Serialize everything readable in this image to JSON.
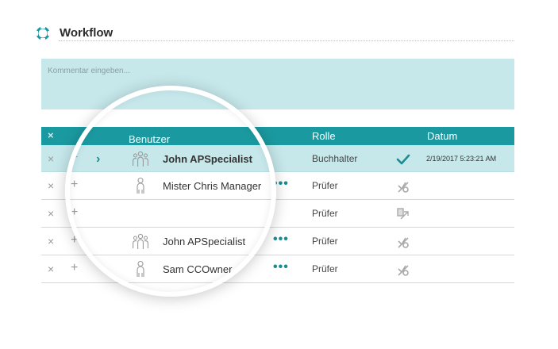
{
  "header": {
    "title": "Workflow",
    "logo_icon": "workflow-ring-icon"
  },
  "comment": {
    "placeholder": "Kommentar eingeben..."
  },
  "table": {
    "columns": {
      "user": "Benutzer",
      "role": "Rolle",
      "date": "Datum"
    },
    "clear_all_symbol": "×",
    "rows": [
      {
        "name": "John APSpecialist",
        "user_icon": "user-group-icon",
        "role": "Buchhalter",
        "status_icon": "check-icon",
        "date": "2/19/2017 5:23:21 AM",
        "active": true,
        "remove": "×",
        "add": "+",
        "expand": "›",
        "menu": ""
      },
      {
        "name": "Mister Chris Manager",
        "user_icon": "user-icon",
        "role": "Prüfer",
        "status_icon": "no-approval-icon",
        "date": "",
        "active": false,
        "remove": "×",
        "add": "+",
        "expand": "",
        "menu": "•••"
      },
      {
        "name": "",
        "user_icon": "",
        "role": "Prüfer",
        "status_icon": "forward-document-icon",
        "date": "",
        "active": false,
        "remove": "×",
        "add": "+",
        "expand": "",
        "menu": ""
      },
      {
        "name": "John APSpecialist",
        "user_icon": "user-group-icon",
        "role": "Prüfer",
        "status_icon": "no-approval-icon",
        "date": "",
        "active": false,
        "remove": "×",
        "add": "+",
        "expand": "",
        "menu": "•••"
      },
      {
        "name": "Sam CCOwner",
        "user_icon": "user-icon",
        "role": "Prüfer",
        "status_icon": "no-approval-icon",
        "date": "",
        "active": false,
        "remove": "×",
        "add": "+",
        "expand": "",
        "menu": "•••"
      }
    ]
  },
  "colors": {
    "accent": "#1a9aa0",
    "comment_bg": "#c6e8eb"
  }
}
